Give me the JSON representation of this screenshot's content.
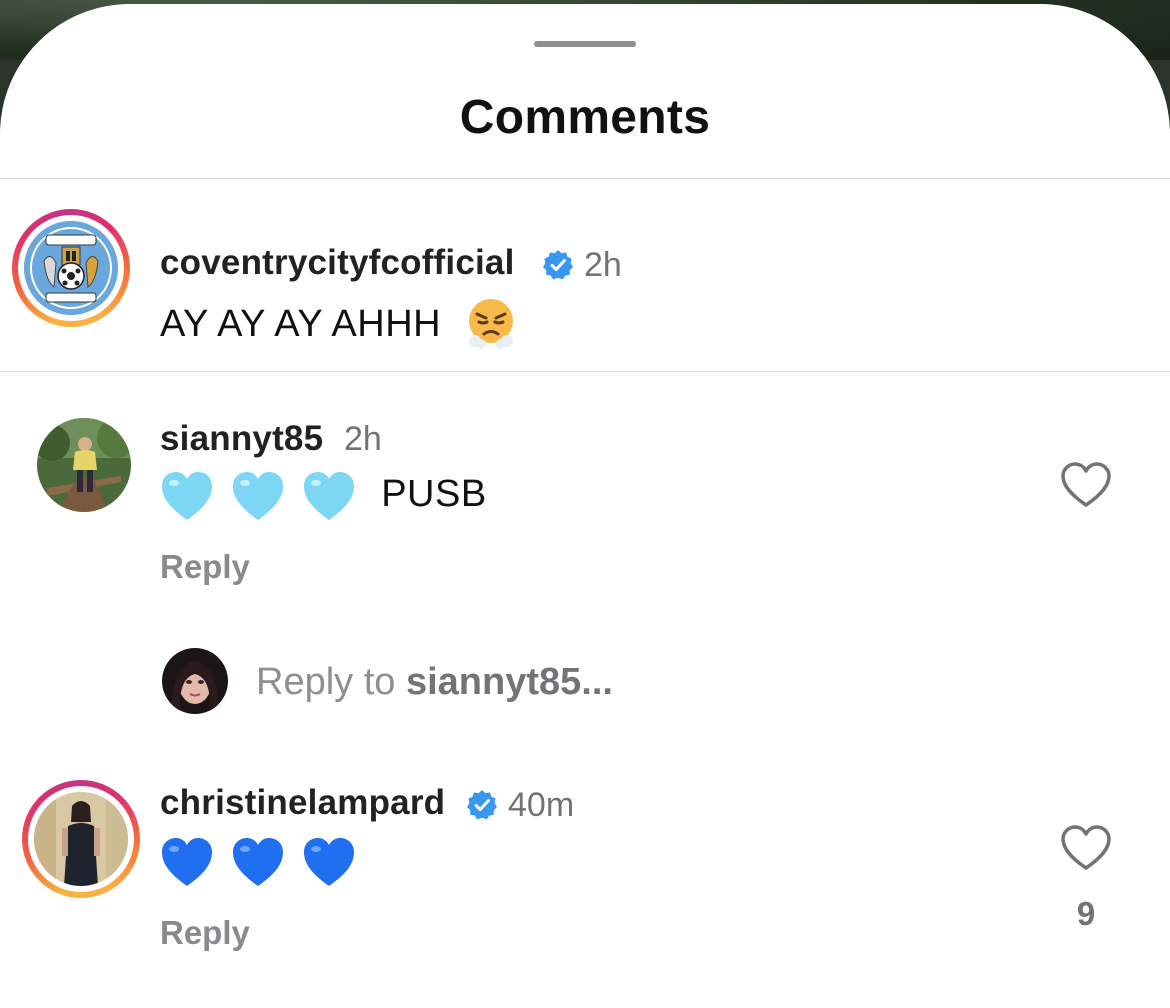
{
  "sheet": {
    "title": "Comments"
  },
  "comments": [
    {
      "username": "coventrycityfcofficial",
      "verified": true,
      "time": "2h",
      "text": "AY AY AY AHHH",
      "emojis": [
        "face-with-steam-from-nose"
      ]
    },
    {
      "username": "siannyt85",
      "verified": false,
      "time": "2h",
      "emojis": [
        "light-blue-heart",
        "light-blue-heart",
        "light-blue-heart"
      ],
      "text": "PUSB",
      "reply_label": "Reply"
    },
    {
      "username": "christinelampard",
      "verified": true,
      "time": "40m",
      "emojis": [
        "blue-heart",
        "blue-heart",
        "blue-heart"
      ],
      "reply_label": "Reply",
      "like_count": "9"
    }
  ],
  "reply_input": {
    "prefix": "Reply to ",
    "target": "siannyt85..."
  },
  "icons": {
    "verified": "verified-badge-icon",
    "like": "heart-outline-icon"
  },
  "colors": {
    "verified": "#3897f0",
    "light_blue_heart": "#7ed6f5",
    "blue_heart": "#1f6ff0"
  }
}
